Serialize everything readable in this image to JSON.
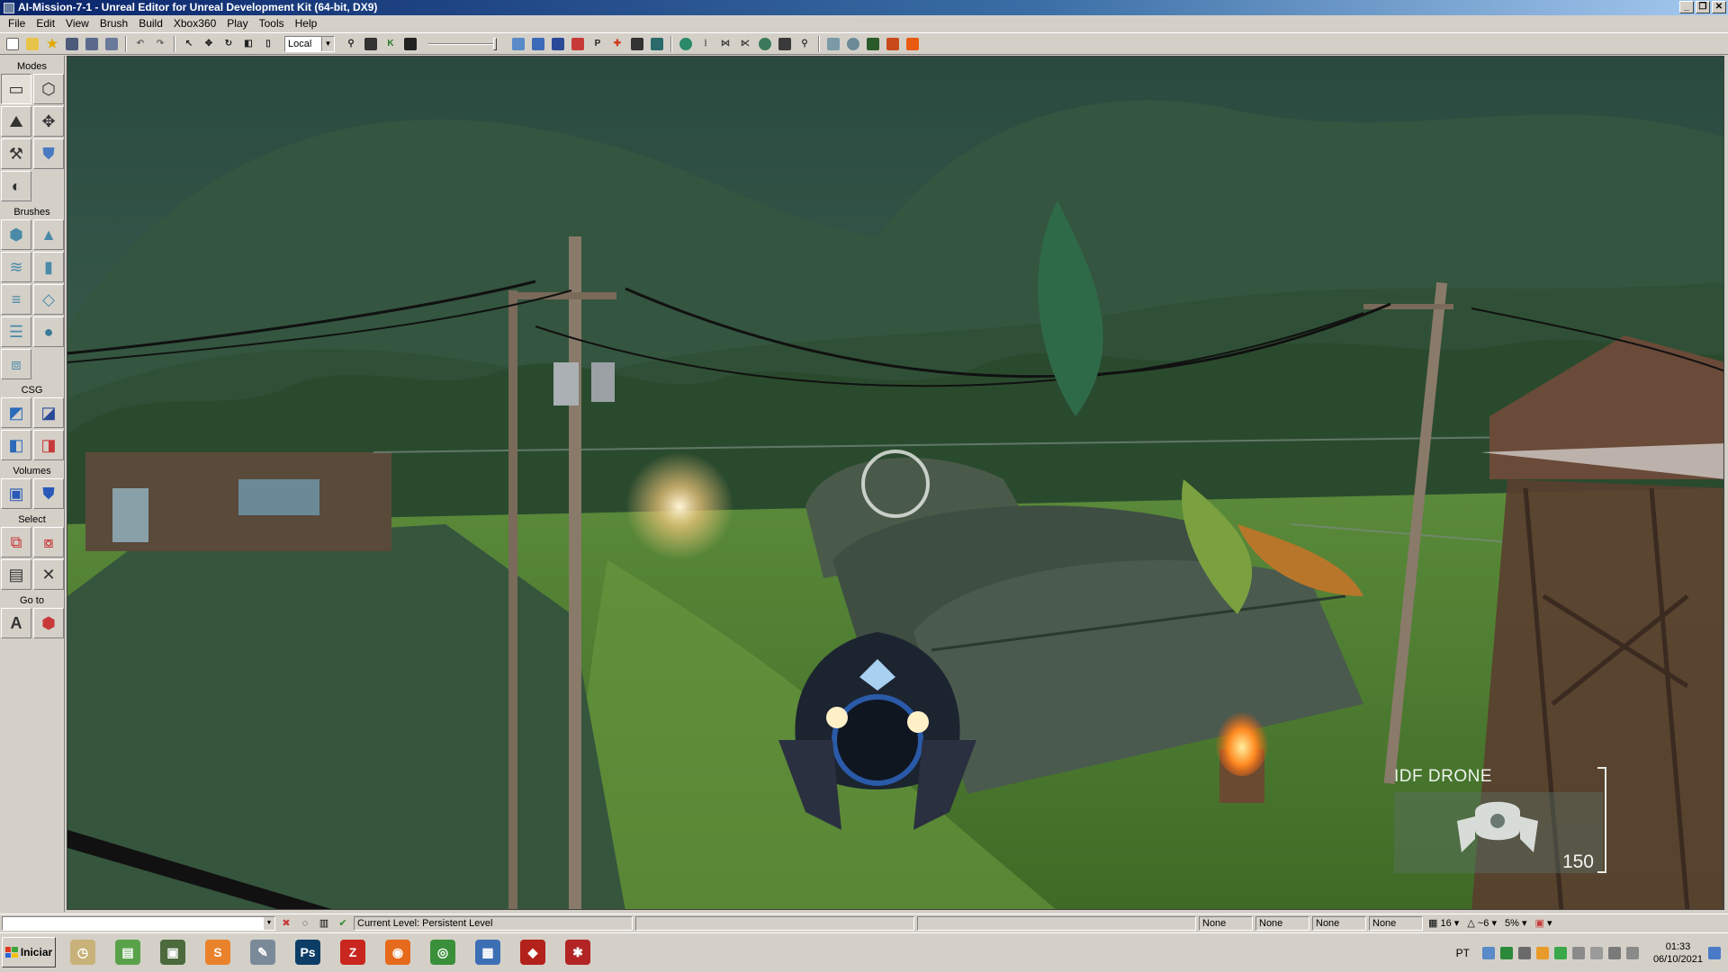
{
  "window": {
    "title": "AI-Mission-7-1 - Unreal Editor for Unreal Development Kit (64-bit, DX9)",
    "controls": [
      "_",
      "❐",
      "✕"
    ]
  },
  "menu": [
    "File",
    "Edit",
    "View",
    "Brush",
    "Build",
    "Xbox360",
    "Play",
    "Tools",
    "Help"
  ],
  "toolbar": {
    "coordinate_system": "Local",
    "letters": [
      "K",
      "P"
    ]
  },
  "panel": {
    "modes_label": "Modes",
    "brushes_label": "Brushes",
    "csg_label": "CSG",
    "volumes_label": "Volumes",
    "select_label": "Select",
    "goto_label": "Go to",
    "goto_actor_glyph": "A"
  },
  "hud": {
    "enemy_name": "IDF DRONE",
    "enemy_value": "150"
  },
  "statusbar": {
    "current_level_label": "Current Level:",
    "current_level_value": "Persistent Level",
    "none_fields": [
      "None",
      "None",
      "None",
      "None"
    ],
    "grid_size": "16",
    "rotation_snap": "~6",
    "scale_snap": "5%"
  },
  "taskbar": {
    "start_label": "Iniciar",
    "apps": [
      {
        "name": "clock-app",
        "glyph": "◷",
        "color": "#c9b27a"
      },
      {
        "name": "chart-app",
        "glyph": "▤",
        "color": "#5aa24a"
      },
      {
        "name": "monitor-app",
        "glyph": "▣",
        "color": "#4c6a3c"
      },
      {
        "name": "sublime-app",
        "glyph": "S",
        "color": "#e9822b"
      },
      {
        "name": "tools-app",
        "glyph": "✎",
        "color": "#7a8a99"
      },
      {
        "name": "photoshop-app",
        "glyph": "Ps",
        "color": "#0c3d66"
      },
      {
        "name": "filezilla-app",
        "glyph": "Z",
        "color": "#c8261e"
      },
      {
        "name": "firefox-app",
        "glyph": "◉",
        "color": "#e66a1b"
      },
      {
        "name": "chrome-app",
        "glyph": "◎",
        "color": "#3a8f3a"
      },
      {
        "name": "network-app",
        "glyph": "▦",
        "color": "#3c6fb4"
      },
      {
        "name": "ruby-app",
        "glyph": "◆",
        "color": "#b3211b"
      },
      {
        "name": "unreal-app",
        "glyph": "✱",
        "color": "#b32424"
      }
    ],
    "language": "PT",
    "time": "01:33",
    "date": "06/10/2021"
  },
  "colors": {
    "title_start": "#0a246a",
    "title_end": "#a6caf0",
    "chrome": "#d4d0c8",
    "hud_text": "#eef4ee"
  }
}
